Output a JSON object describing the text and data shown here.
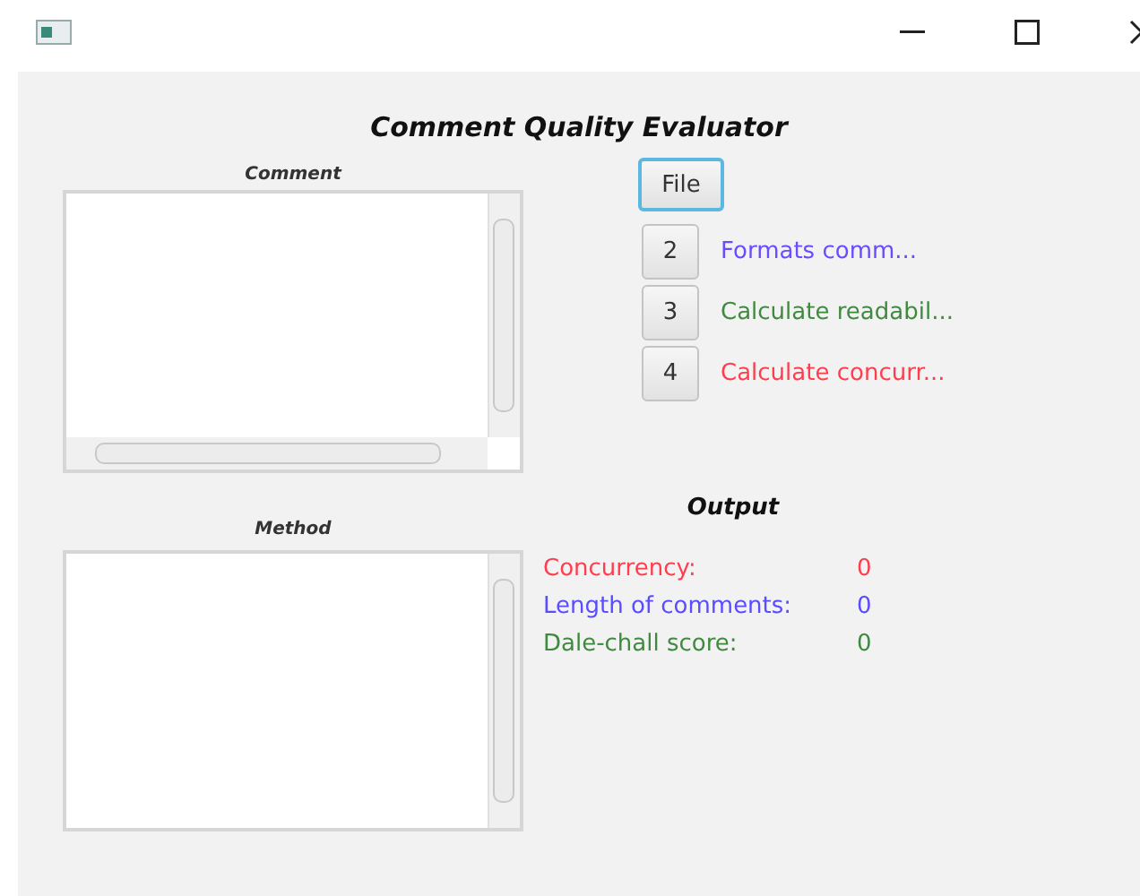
{
  "title": "Comment Quality Evaluator",
  "comment": {
    "label": "Comment",
    "horizontal_scroll": true
  },
  "method": {
    "label": "Method",
    "horizontal_scroll": false
  },
  "file_button": {
    "label": "File",
    "focused": true
  },
  "steps": [
    {
      "number": "2",
      "description": "Formats comm...",
      "color": "#6a4cff"
    },
    {
      "number": "3",
      "description": "Calculate readabil...",
      "color": "#3f8a3f"
    },
    {
      "number": "4",
      "description": "Calculate concurr...",
      "color": "#ff3d4f"
    }
  ],
  "output": {
    "title": "Output",
    "rows": [
      {
        "label": "Concurrency:",
        "value": "0",
        "color": "#ff3d4f"
      },
      {
        "label": "Length of comments:",
        "value": "0",
        "color": "#5a4cff"
      },
      {
        "label": "Dale-chall score:",
        "value": "0",
        "color": "#3f8a3f"
      }
    ]
  }
}
